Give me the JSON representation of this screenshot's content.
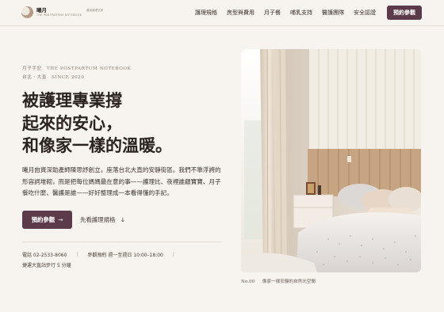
{
  "brand": {
    "name": "曦月",
    "subtitle": "THE POSTPARTUM NOTEBOOK",
    "tagline": "產後護理之家"
  },
  "nav": {
    "items": [
      "護理規格",
      "房型與費用",
      "月子餐",
      "哺乳支持",
      "醫護團隊",
      "安全認證"
    ],
    "cta": "預約參觀"
  },
  "hero": {
    "eyebrow": "月子手記　THE POSTPARTUM NOTEBOOK",
    "location": "台北・大直　SINCE 2020",
    "headline": [
      "被護理專業撐",
      "起來的安心，",
      "和像家一樣的溫暖。"
    ],
    "body": "曦月由資深助產師陳思妤創立，座落台北大直的安靜街區。我們不靠浮誇的形容詞堆砌，而是把每位媽媽最在意的事——護理比、夜裡誰顧寶寶、月子餐吃什麼、醫護是誰——好好整理成一本看得懂的手記。",
    "cta_primary": "預約參觀",
    "cta_primary_arrow": "→",
    "cta_secondary": "先看護理規格",
    "cta_secondary_arrow": "↓"
  },
  "contact": {
    "phone": "電話 02-2533-8060",
    "hours": "參觀預約 週一至週日 10:00–18:00",
    "walk": "捷運大直站步行 5 分鐘"
  },
  "photo": {
    "caption_num": "No.00",
    "caption_text": "像家一樣安靜的自然光空間"
  }
}
